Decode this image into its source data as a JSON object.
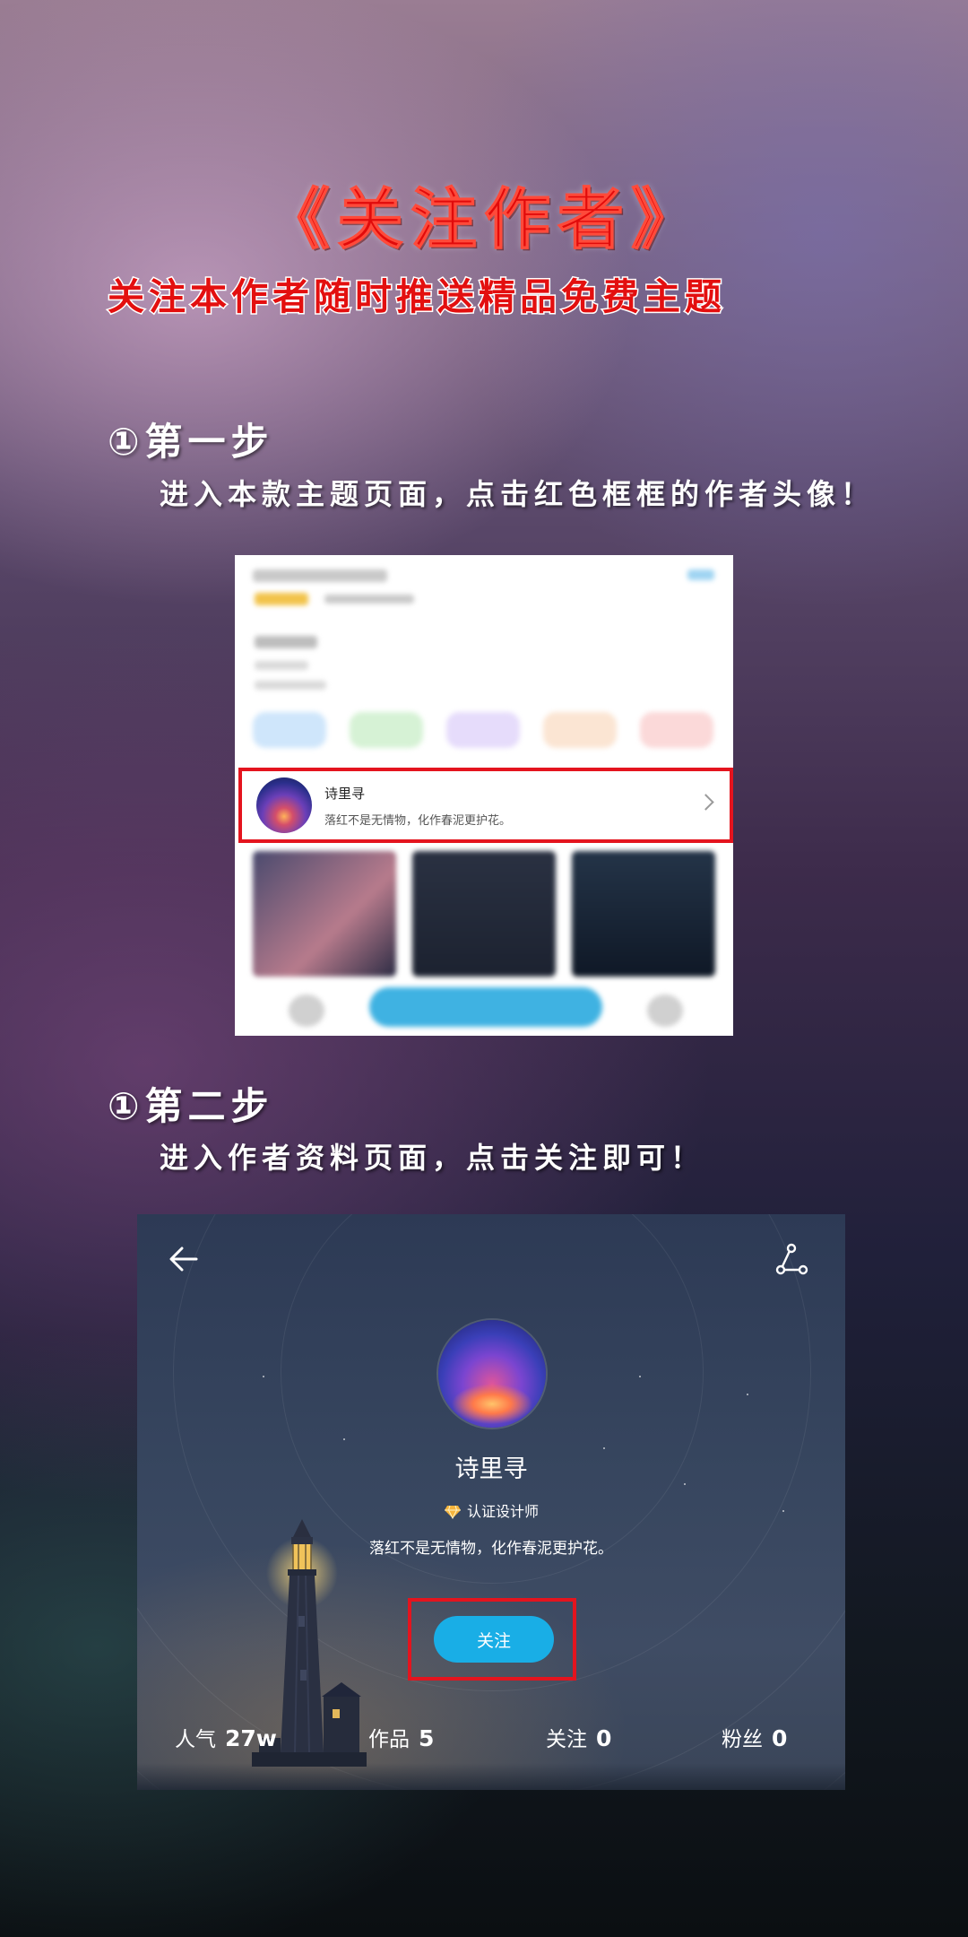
{
  "header": {
    "title": "《关注作者》",
    "subtitle": "关注本作者随时推送精品免费主题"
  },
  "step1": {
    "heading": "①第一步",
    "description": "进入本款主题页面，点击红色框框的作者头像！",
    "author_row": {
      "name": "诗里寻",
      "bio": "落红不是无情物，化作春泥更护花。"
    }
  },
  "step2": {
    "heading": "①第二步",
    "description": "进入作者资料页面，点击关注即可！",
    "profile": {
      "name": "诗里寻",
      "badge": "认证设计师",
      "bio": "落红不是无情物，化作春泥更护花。",
      "follow_label": "关注",
      "stats": [
        {
          "label": "人气",
          "value": "27w"
        },
        {
          "label": "作品",
          "value": "5"
        },
        {
          "label": "关注",
          "value": "0"
        },
        {
          "label": "粉丝",
          "value": "0"
        }
      ]
    }
  },
  "colors": {
    "title_red": "#e10b0b",
    "highlight_frame": "#e4141e",
    "follow_button": "#19aee6"
  }
}
